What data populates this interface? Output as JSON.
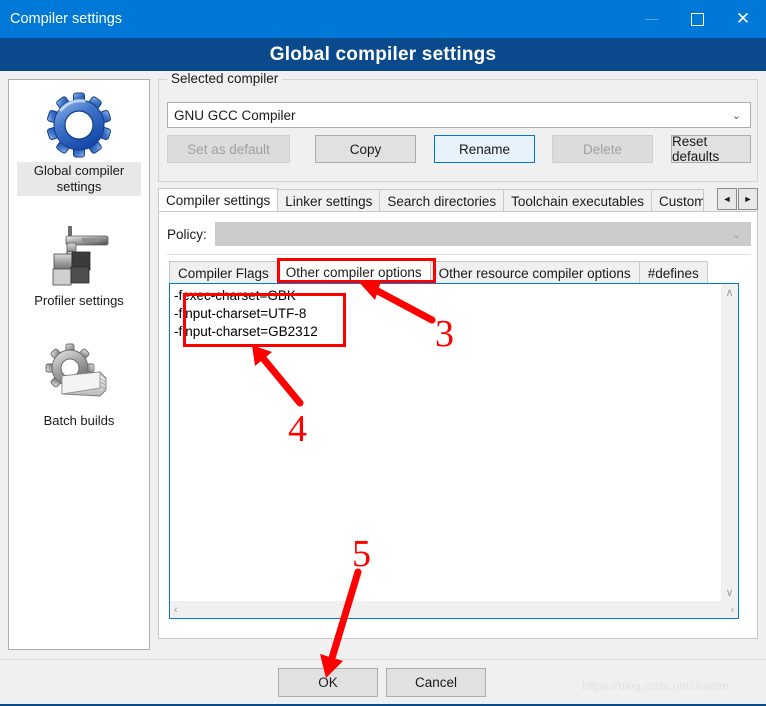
{
  "window": {
    "title": "Compiler settings",
    "banner": "Global compiler settings",
    "minimize_icon": "minimize-icon",
    "maximize_icon": "maximize-icon",
    "close_icon": "close-icon",
    "accent_color": "#0078d7",
    "banner_color": "#0a4a8c"
  },
  "sidebar": {
    "items": [
      {
        "label": "Global compiler settings",
        "icon": "gear-icon",
        "selected": true
      },
      {
        "label": "Profiler settings",
        "icon": "caliper-icon",
        "selected": false
      },
      {
        "label": "Batch builds",
        "icon": "gear-stack-icon",
        "selected": false
      }
    ]
  },
  "selected_compiler": {
    "group_title": "Selected compiler",
    "combo_value": "GNU GCC Compiler",
    "chevron": "⌄",
    "buttons": [
      {
        "label": "Set as default",
        "state": "disabled"
      },
      {
        "label": "Copy",
        "state": "normal"
      },
      {
        "label": "Rename",
        "state": "focused"
      },
      {
        "label": "Delete",
        "state": "disabled"
      },
      {
        "label": "Reset defaults",
        "state": "normal"
      }
    ]
  },
  "tabs": {
    "items": [
      {
        "label": "Compiler settings",
        "active": true
      },
      {
        "label": "Linker settings",
        "active": false
      },
      {
        "label": "Search directories",
        "active": false
      },
      {
        "label": "Toolchain executables",
        "active": false
      },
      {
        "label": "Custom",
        "active": false
      }
    ],
    "scroll_left_icon": "triangle-left-icon",
    "scroll_left_glyph": "◄",
    "scroll_right_icon": "triangle-right-icon",
    "scroll_right_glyph": "►"
  },
  "policy": {
    "label": "Policy:",
    "value": "",
    "chevron": "⌄",
    "state": "disabled"
  },
  "inner_tabs": {
    "items": [
      {
        "label": "Compiler Flags",
        "active": false
      },
      {
        "label": "Other compiler options",
        "active": true
      },
      {
        "label": "Other resource compiler options",
        "active": false
      },
      {
        "label": "#defines",
        "active": false
      }
    ]
  },
  "editor": {
    "value": "-fexec-charset=GBK\n-finput-charset=UTF-8\n-finput-charset=GB2312",
    "vscroll_up_glyph": "∧",
    "vscroll_down_glyph": "∨",
    "hscroll_left_glyph": "‹",
    "hscroll_right_glyph": "›"
  },
  "dialog_buttons": {
    "ok": "OK",
    "cancel": "Cancel"
  },
  "watermark": "https://blog.csdn.net/Jeaten",
  "annotations": {
    "color": "#fe0000",
    "numbers": [
      {
        "id": "3",
        "text": "3",
        "points_to": "other-compiler-options-tab"
      },
      {
        "id": "4",
        "text": "4",
        "points_to": "compiler-options-editor"
      },
      {
        "id": "5",
        "text": "5",
        "points_to": "ok-button"
      }
    ]
  }
}
